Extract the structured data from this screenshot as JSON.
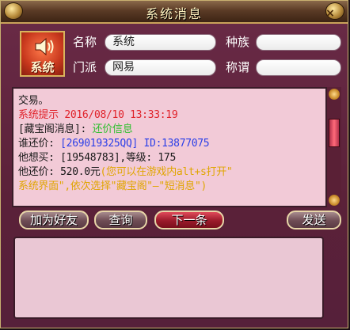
{
  "window": {
    "title": "系统消息",
    "close_glyph": "×"
  },
  "sender": {
    "icon": "speaker-icon",
    "icon_label": "系统",
    "name_label": "名称",
    "name_value": "系统",
    "race_label": "种族",
    "race_value": "",
    "faction_label": "门派",
    "faction_value": "网易",
    "title_label": "称谓",
    "title_value": ""
  },
  "message": {
    "line1": "交易。",
    "line2_prefix": "系统提示",
    "line2_time": " 2016/08/10 13:33:19",
    "line3_prefix": "[藏宝阁消息]: ",
    "line3_tag": "还价信息",
    "line4_prefix": "谁还价:  ",
    "line4_value": "[269019325QQ] ID:13877075",
    "line5": "他想买: [19548783],等级: 175",
    "line6_prefix": "他还价: 520.0元",
    "line6_tip": "(您可以在游戏内alt+s打开\"",
    "line7": "系统界面\",依次选择\"藏宝阁\"—\"短消息\")"
  },
  "buttons": {
    "add_friend": "加为好友",
    "query": "查询",
    "next": "下一条",
    "send": "发送"
  },
  "colors": {
    "system": "#e0222a",
    "tag": "#2fbf2f",
    "link": "#2a3ee8",
    "tip": "#e0a500"
  }
}
